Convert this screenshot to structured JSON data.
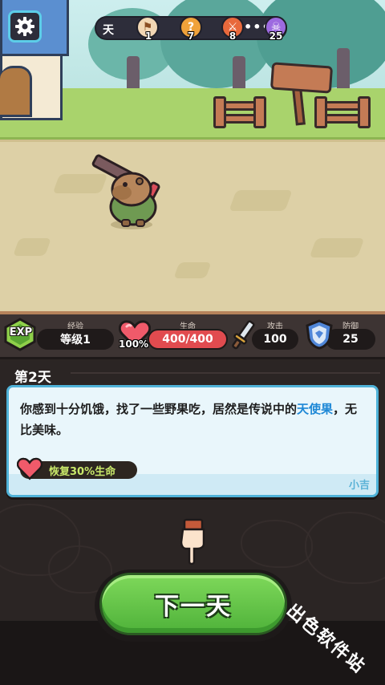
{
  "hud": {
    "day_label": "天",
    "stages": [
      {
        "icon": "flag-icon",
        "count": "1",
        "color": "#e9a24c"
      },
      {
        "icon": "question-icon",
        "count": "7",
        "color": "#f0a23a"
      },
      {
        "icon": "crossed-swords-icon",
        "count": "8",
        "color": "#e8693c"
      },
      {
        "icon": "skull-icon",
        "count": "25",
        "color": "#9d6ae0"
      }
    ],
    "more": "•••"
  },
  "stats": {
    "exp": {
      "title": "经验",
      "value": "等级1",
      "badge": "EXP"
    },
    "hp": {
      "title": "生命",
      "value": "400/400",
      "percent": "100%"
    },
    "attack": {
      "title": "攻击",
      "value": "100"
    },
    "defense": {
      "title": "防御",
      "value": "25"
    }
  },
  "event": {
    "day_title": "第2天",
    "text_before": "你感到十分饥饿，找了一些野果吃，居然是传说中的",
    "text_highlight": "天使果",
    "text_after": "，无比美味。",
    "effect": "恢复30%生命",
    "npc": "小吉"
  },
  "next_button": "下一天",
  "watermark": "出色软件站",
  "colors": {
    "accent": "#5ccde8",
    "hp": "#e14b4f",
    "highlight": "#1e88d6",
    "button": "#5fc244"
  }
}
